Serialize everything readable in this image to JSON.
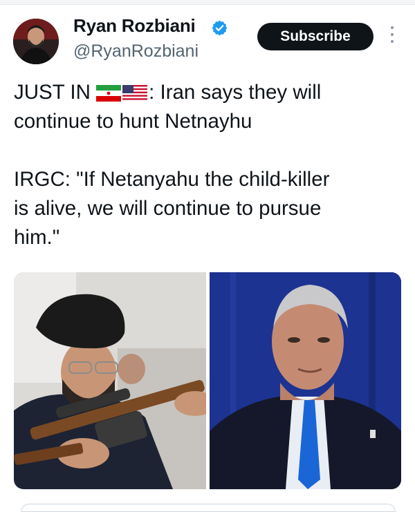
{
  "author": {
    "name": "Ryan Rozbiani",
    "handle": "@RyanRozbiani",
    "verified": true,
    "verified_icon": "verified-badge-icon",
    "verified_color": "#1d9bf0"
  },
  "actions": {
    "subscribe_label": "Subscribe",
    "more_icon": "vertical-ellipsis-icon"
  },
  "tweet": {
    "line1_prefix": "JUST IN ",
    "flags": [
      "iran-flag-icon",
      "us-flag-icon"
    ],
    "line1_suffix": ": Iran says they will",
    "line2": "continue to hunt Netnayhu",
    "line3": "IRGC: \"If Netanyahu the child-killer",
    "line4": "is alive, we will continue to pursue",
    "line5": "him.\""
  },
  "media": {
    "left_photo": "cleric-aiming-rifle-photo",
    "right_photo": "netanyahu-portrait-photo"
  },
  "colors": {
    "text": "#0f1419",
    "secondary_text": "#536471",
    "button_bg": "#0f1419",
    "button_text": "#ffffff"
  }
}
